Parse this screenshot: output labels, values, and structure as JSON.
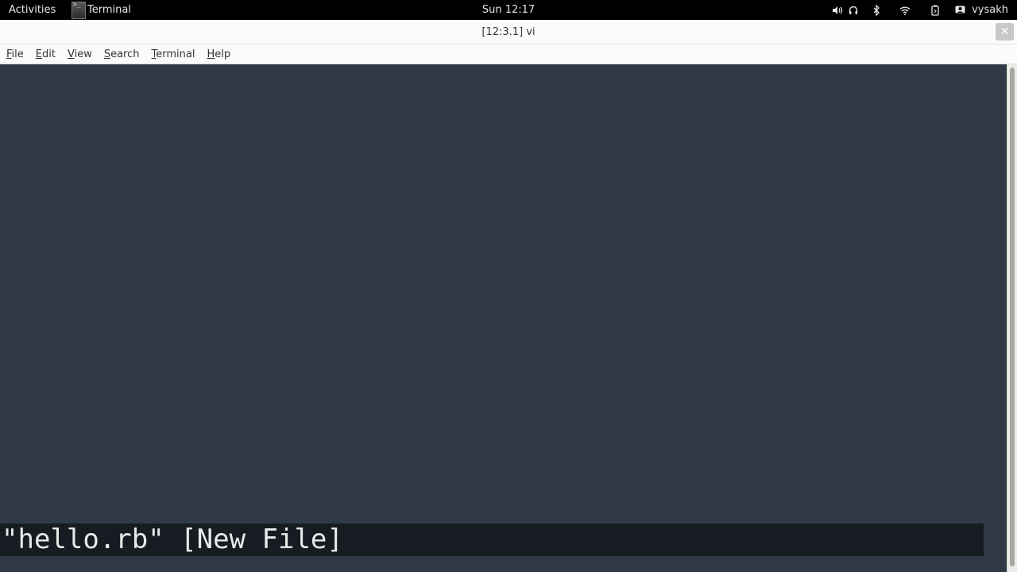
{
  "topbar": {
    "activities": "Activities",
    "app_name": "Terminal",
    "clock": "Sun 12:17",
    "user": "vysakh",
    "icons": [
      "volume-icon",
      "headphones-icon",
      "bluetooth-icon",
      "wifi-icon",
      "battery-icon",
      "user-icon"
    ]
  },
  "window": {
    "title": "[12:3.1] vi",
    "close_glyph": "✕"
  },
  "menubar": {
    "items": [
      {
        "first": "F",
        "rest": "ile"
      },
      {
        "first": "E",
        "rest": "dit"
      },
      {
        "first": "V",
        "rest": "iew"
      },
      {
        "first": "S",
        "rest": "earch"
      },
      {
        "first": "T",
        "rest": "erminal"
      },
      {
        "first": "H",
        "rest": "elp"
      }
    ]
  },
  "terminal": {
    "background_color": "#2f3a46",
    "status_message": "\"hello.rb\" [New File]"
  }
}
